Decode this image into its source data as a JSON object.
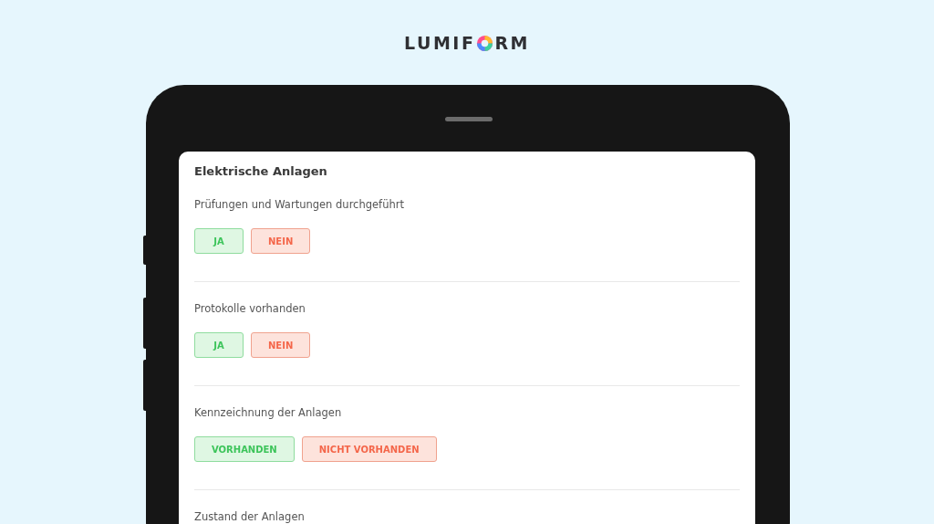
{
  "logo": {
    "before": "LUMIF",
    "after": "RM"
  },
  "form": {
    "title": "Elektrische Anlagen",
    "questions": [
      {
        "label": "Prüfungen und Wartungen durchgeführt",
        "options": [
          {
            "label": "JA",
            "kind": "positive"
          },
          {
            "label": "NEIN",
            "kind": "negative"
          }
        ]
      },
      {
        "label": "Protokolle vorhanden",
        "options": [
          {
            "label": "JA",
            "kind": "positive"
          },
          {
            "label": "NEIN",
            "kind": "negative"
          }
        ]
      },
      {
        "label": "Kennzeichnung der Anlagen",
        "options": [
          {
            "label": "VORHANDEN",
            "kind": "positive"
          },
          {
            "label": "NICHT VORHANDEN",
            "kind": "negative"
          }
        ]
      },
      {
        "label": "Zustand der Anlagen"
      }
    ]
  }
}
